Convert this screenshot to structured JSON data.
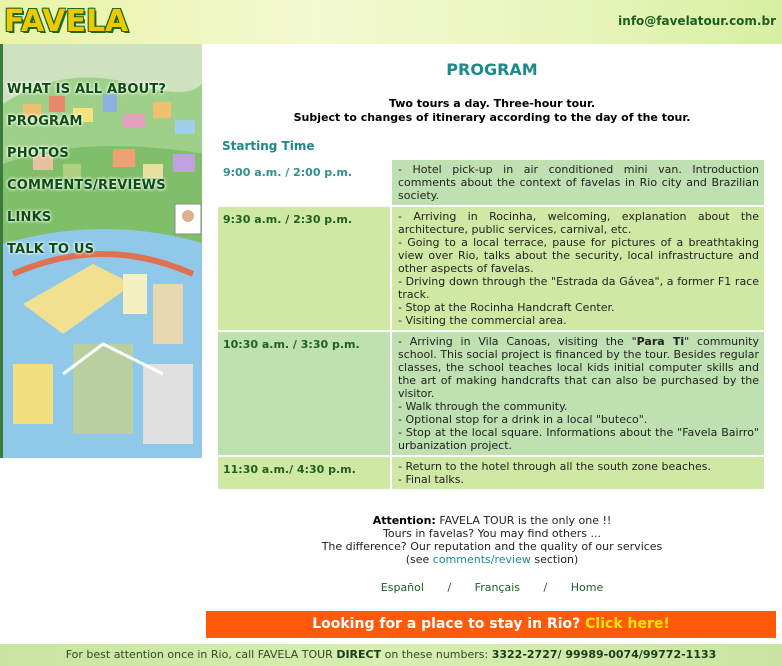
{
  "header": {
    "logo_text": "FAVELA TOUR",
    "email": "info@favelatour.com.br"
  },
  "sidebar": {
    "items": [
      {
        "label": "WHAT IS ALL ABOUT?"
      },
      {
        "label": "PROGRAM"
      },
      {
        "label": "PHOTOS"
      },
      {
        "label": "COMMENTS/REVIEWS"
      },
      {
        "label": "LINKS"
      },
      {
        "label": "TALK TO US"
      }
    ]
  },
  "main": {
    "title": "PROGRAM",
    "subtitle_line1": "Two tours a day. Three-hour tour.",
    "subtitle_line2": "Subject to changes of itinerary according to the day of the tour.",
    "starting_time_label": "Starting Time",
    "schedule": [
      {
        "time": "9:00 a.m. / 2:00 p.m.",
        "lines": [
          "- Hotel pick-up in air conditioned mini van. Introduction comments about the context of favelas in Rio city and Brazilian society."
        ]
      },
      {
        "time": "9:30 a.m. / 2:30 p.m.",
        "lines": [
          "- Arriving in Rocinha, welcoming, explanation about the architecture, public services, carnival, etc.",
          "- Going to a local terrace, pause for pictures of a breathtaking view over Rio, talks about the security, local infrastructure and other aspects of favelas.",
          "- Driving down through the \"Estrada da Gávea\", a former F1 race track.",
          "- Stop at the Rocinha Handcraft Center.",
          "- Visiting the commercial area."
        ]
      },
      {
        "time": "10:30 a.m. / 3:30 p.m.",
        "lines_pre": "- Arriving in Vila Canoas, visiting the \"",
        "highlight": "Para Ti",
        "lines_post": "\" community school. This social project is financed by the tour. Besides regular classes, the school teaches local kids initial computer skills and the art of making handcrafts that can also be purchased by the visitor.",
        "lines": [
          "- Walk through the community.",
          "- Optional stop for a drink in a local \"buteco\".",
          "- Stop at the local square. Informations about the \"Favela Bairro\" urbanization project."
        ]
      },
      {
        "time": "11:30 a.m./ 4:30 p.m.",
        "lines": [
          "- Return to the hotel through all the south zone beaches.",
          "- Final talks."
        ]
      }
    ],
    "attention_label": "Attention:",
    "attention_text": " FAVELA TOUR is the only one !!",
    "attention_line2": "Tours in favelas? You may find others ...",
    "attention_line3": "The difference? Our reputation and the quality of our services",
    "attention_line4_pre": "(see ",
    "attention_link": "comments/review",
    "attention_line4_post": " section)"
  },
  "languages": {
    "espanol": "Español",
    "sep": "/",
    "francais": "Français",
    "home": "Home"
  },
  "banner": {
    "text": "Looking for a place to stay in Rio? ",
    "cta": "Click here!"
  },
  "footer": {
    "pre": "For best attention once in Rio, call FAVELA TOUR ",
    "direct": "DIRECT",
    "mid": " on these numbers: ",
    "numbers": "3322-2727/ 99989-0074/99772-1133"
  },
  "colors": {
    "accent_teal": "#1c8a8a",
    "green_dark": "#1b5e20",
    "banner_orange": "#ff5a0a",
    "banner_highlight": "#ffe600"
  }
}
